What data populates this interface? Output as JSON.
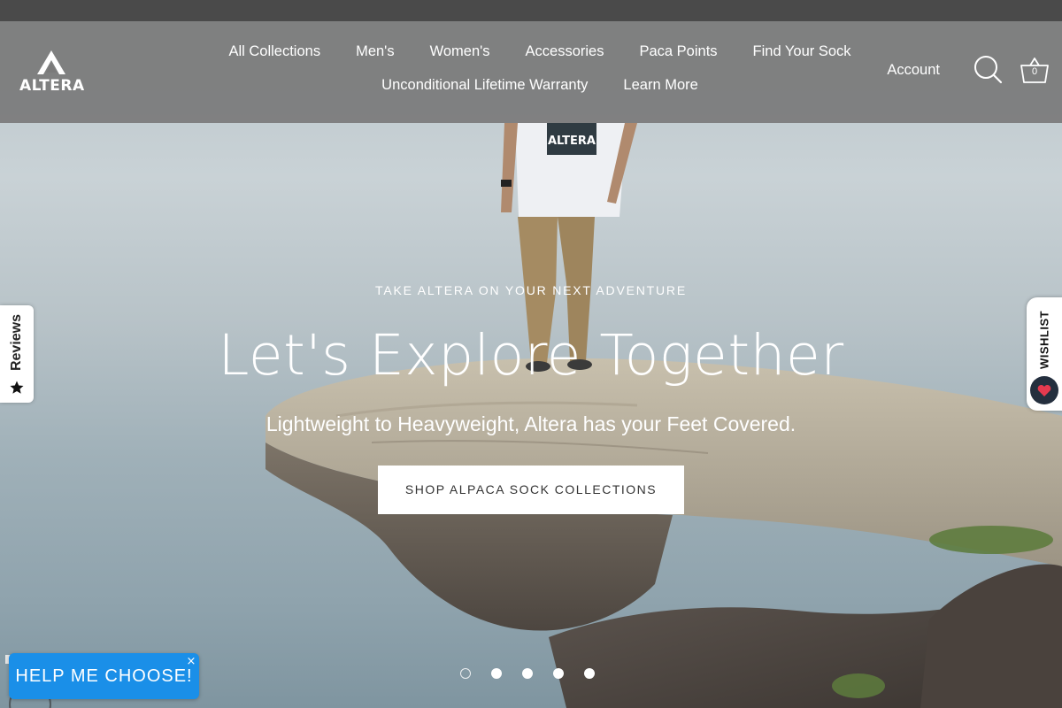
{
  "header": {
    "logo_text": "ALTERA",
    "nav_row1": [
      "All Collections",
      "Men's",
      "Women's",
      "Accessories",
      "Paca Points",
      "Find Your Sock"
    ],
    "nav_row2": [
      "Unconditional Lifetime Warranty",
      "Learn More"
    ],
    "account_label": "Account",
    "cart_count": "0"
  },
  "hero": {
    "kicker": "TAKE ALTERA ON YOUR NEXT ADVENTURE",
    "title": "Let's Explore Together",
    "subtitle": "Lightweight to Heavyweight, Altera has your Feet Covered.",
    "cta_label": "SHOP ALPACA SOCK COLLECTIONS",
    "shirt_text": "ALTERA"
  },
  "slider": {
    "count": 5,
    "active_index": 0
  },
  "reviews_tab": {
    "label": "Reviews"
  },
  "wishlist_tab": {
    "label": "WISHLIST"
  },
  "help_widget": {
    "label": "HELP ME CHOOSE!",
    "close_label": "×"
  },
  "colors": {
    "promo_bar": "#4a4a4a",
    "header_bg": "#7a7a7a",
    "help_button": "#1a8fe8",
    "wishlist_heart_bg": "#242f3e",
    "heart": "#e53a4f"
  },
  "icons": {
    "search": "search-icon",
    "cart": "basket-icon",
    "star": "star-icon",
    "heart": "heart-icon"
  }
}
